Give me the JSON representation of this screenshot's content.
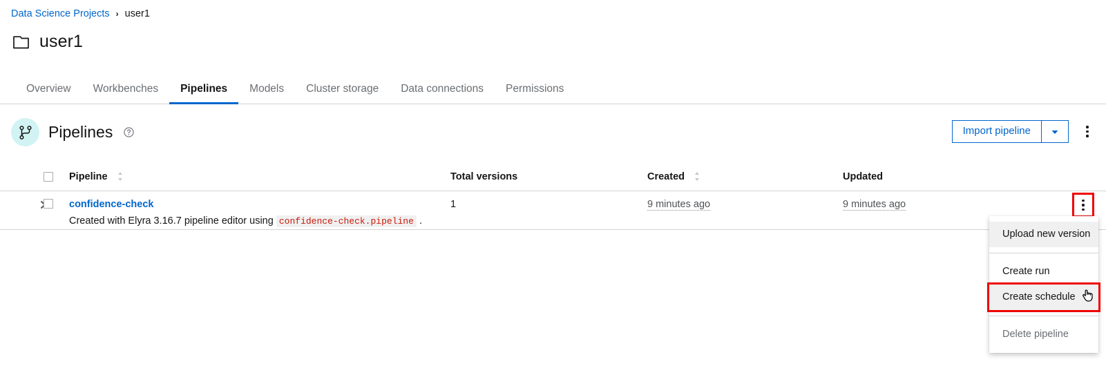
{
  "breadcrumb": {
    "root_label": "Data Science Projects",
    "separator": "›",
    "current_label": "user1"
  },
  "header": {
    "title": "user1",
    "icon": "folder-icon"
  },
  "tabs": [
    {
      "label": "Overview",
      "active": false
    },
    {
      "label": "Workbenches",
      "active": false
    },
    {
      "label": "Pipelines",
      "active": true
    },
    {
      "label": "Models",
      "active": false
    },
    {
      "label": "Cluster storage",
      "active": false
    },
    {
      "label": "Data connections",
      "active": false
    },
    {
      "label": "Permissions",
      "active": false
    }
  ],
  "toolbar": {
    "section_icon": "git-branch-icon",
    "section_title": "Pipelines",
    "help_icon": "help-circle-icon",
    "import_label": "Import pipeline",
    "import_caret_icon": "chevron-down-icon",
    "actions_kebab_icon": "kebab-vertical-icon"
  },
  "table": {
    "columns": [
      {
        "key": "select",
        "label": ""
      },
      {
        "key": "pipeline",
        "label": "Pipeline",
        "sortable": true
      },
      {
        "key": "total_versions",
        "label": "Total versions",
        "sortable": false
      },
      {
        "key": "created",
        "label": "Created",
        "sortable": true
      },
      {
        "key": "updated",
        "label": "Updated",
        "sortable": false
      }
    ],
    "rows": [
      {
        "expand_icon": "chevron-right-icon",
        "selected": false,
        "name": "confidence-check",
        "description_prefix": "Created with Elyra 3.16.7 pipeline editor using",
        "description_code": "confidence-check.pipeline",
        "description_suffix": ".",
        "total_versions": "1",
        "created": "9 minutes ago",
        "updated": "9 minutes ago",
        "row_kebab_icon": "kebab-vertical-icon"
      }
    ]
  },
  "menu": {
    "items": [
      {
        "label": "Upload new version",
        "state": "hovered",
        "divider_after": true
      },
      {
        "label": "Create run",
        "state": "normal",
        "divider_after": false
      },
      {
        "label": "Create schedule",
        "state": "selected",
        "divider_after": true
      },
      {
        "label": "Delete pipeline",
        "state": "disabled",
        "divider_after": false
      }
    ]
  },
  "colors": {
    "link": "#0066cc",
    "accent_tab_underline": "#0066cc",
    "annotation_highlight": "#ee0000",
    "badge_background": "#d2f3f3",
    "code_text": "#c9190b",
    "code_background": "#f0f0f0",
    "border": "#d2d2d2",
    "muted_text": "#6a6e73"
  }
}
